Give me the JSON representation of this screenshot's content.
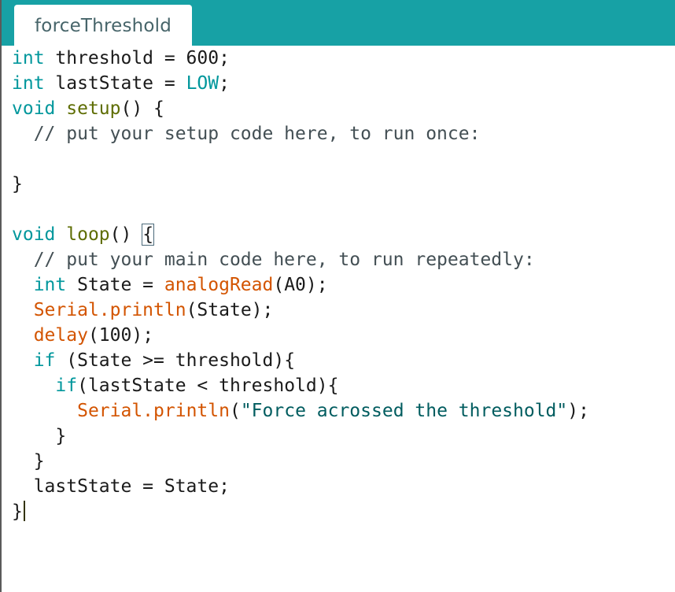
{
  "window": {
    "tab_label": "forceThreshold"
  },
  "code": {
    "line1": {
      "kw": "int",
      "rest": " threshold = 600;"
    },
    "line2": {
      "kw": "int",
      "rest": " lastState = ",
      "const": "LOW",
      "end": ";"
    },
    "line3": {
      "kw": "void",
      "sp": " ",
      "fn": "setup",
      "rest": "() {"
    },
    "line4": {
      "comment": "  // put your setup code here, to run once:"
    },
    "line6": {
      "text": "}"
    },
    "line8": {
      "kw": "void",
      "sp": " ",
      "fn": "loop",
      "rest": "() ",
      "brace": "{"
    },
    "line9": {
      "comment": "  // put your main code here, to run repeatedly:"
    },
    "line10": {
      "indent": "  ",
      "kw": "int",
      "mid": " State = ",
      "lib": "analogRead",
      "rest": "(A0);"
    },
    "line11": {
      "indent": "  ",
      "lib": "Serial.println",
      "rest": "(State);"
    },
    "line12": {
      "indent": "  ",
      "lib": "delay",
      "rest": "(100);"
    },
    "line13": {
      "indent": "  ",
      "kw": "if",
      "rest": " (State >= threshold){"
    },
    "line14": {
      "indent": "    ",
      "kw": "if",
      "rest": "(lastState < threshold){"
    },
    "line15": {
      "indent": "      ",
      "lib": "Serial.println",
      "open": "(",
      "str": "\"Force acrossed the threshold\"",
      "rest": ");"
    },
    "line16": {
      "text": "    }"
    },
    "line17": {
      "text": "  }"
    },
    "line18": {
      "text": "  lastState = State;"
    },
    "line19": {
      "text": "}"
    }
  },
  "colors": {
    "tabbar": "#17a1a5",
    "keyword": "#00979c",
    "function": "#5e6d03",
    "library": "#d35400",
    "string": "#005c5f"
  }
}
